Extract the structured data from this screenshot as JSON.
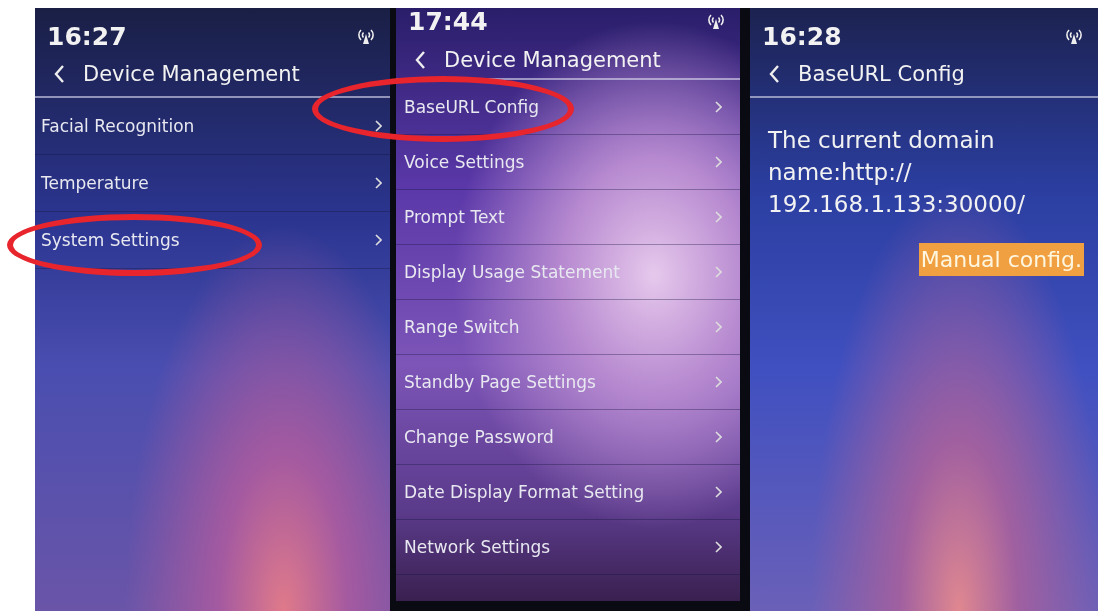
{
  "panels": [
    {
      "kind": "menu",
      "time": "16:27",
      "title": "Device Management",
      "items": [
        {
          "label": "Facial Recognition",
          "circled": false
        },
        {
          "label": "Temperature",
          "circled": false
        },
        {
          "label": "System Settings",
          "circled": true
        }
      ]
    },
    {
      "kind": "menu",
      "time": "17:44",
      "title": "Device Management",
      "items": [
        {
          "label": "BaseURL Config",
          "circled": true
        },
        {
          "label": "Voice Settings",
          "circled": false
        },
        {
          "label": "Prompt Text",
          "circled": false
        },
        {
          "label": "Display Usage Statement",
          "circled": false
        },
        {
          "label": "Range Switch",
          "circled": false
        },
        {
          "label": "Standby Page Settings",
          "circled": false
        },
        {
          "label": "Change Password",
          "circled": false
        },
        {
          "label": "Date Display Format Setting",
          "circled": false
        },
        {
          "label": "Network Settings",
          "circled": false
        }
      ]
    },
    {
      "kind": "detail",
      "time": "16:28",
      "title": "BaseURL Config",
      "message": "The current domain\nname:http://\n192.168.1.133:30000/",
      "button": "Manual config."
    }
  ]
}
